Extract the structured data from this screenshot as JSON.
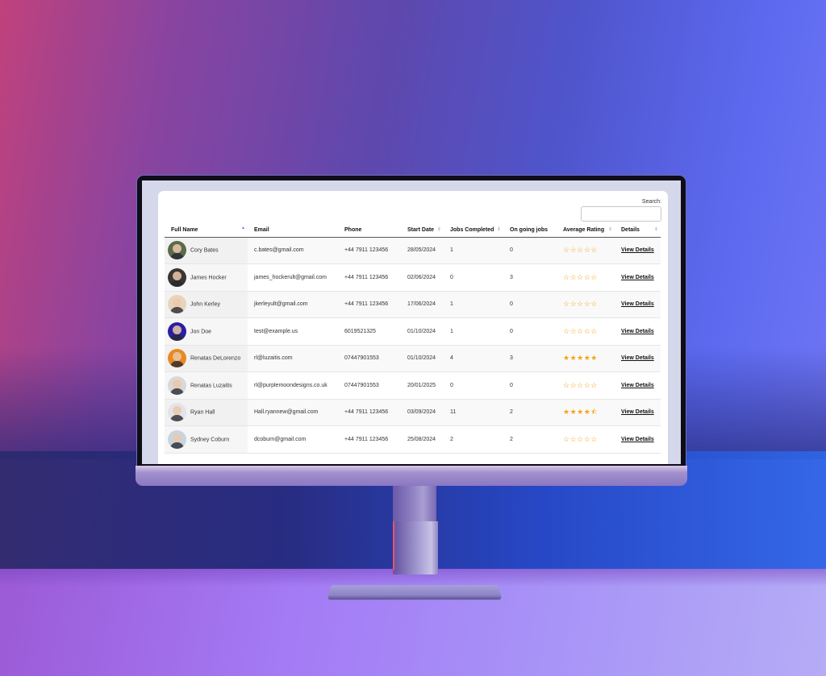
{
  "search": {
    "label": "Search:",
    "value": "",
    "placeholder": ""
  },
  "table": {
    "columns": [
      {
        "label": "Full Name",
        "sort": "asc"
      },
      {
        "label": "Email",
        "sort": "none"
      },
      {
        "label": "Phone",
        "sort": "none"
      },
      {
        "label": "Start Date",
        "sort": "sortable"
      },
      {
        "label": "Jobs Completed",
        "sort": "sortable"
      },
      {
        "label": "On going jobs",
        "sort": "none"
      },
      {
        "label": "Average Rating",
        "sort": "sortable"
      },
      {
        "label": "Details",
        "sort": "sortable"
      }
    ],
    "rows": [
      {
        "name": "Cory Bates",
        "email": "c.bates@gmail.com",
        "phone": "+44 7911 123456",
        "start_date": "28/05/2024",
        "jobs_completed": "1",
        "ongoing_jobs": "0",
        "rating": 0,
        "stars": "☆☆☆☆☆",
        "details": "View Details",
        "avatar_color": "#5a6a4a"
      },
      {
        "name": "James Hocker",
        "email": "james_hockerult@gmail.com",
        "phone": "+44 7911 123456",
        "start_date": "02/06/2024",
        "jobs_completed": "0",
        "ongoing_jobs": "3",
        "rating": 0,
        "stars": "☆☆☆☆☆",
        "details": "View Details",
        "avatar_color": "#3a3530"
      },
      {
        "name": "John Kerley",
        "email": "jkerleyult@gmail.com",
        "phone": "+44 7911 123456",
        "start_date": "17/06/2024",
        "jobs_completed": "1",
        "ongoing_jobs": "0",
        "rating": 0,
        "stars": "☆☆☆☆☆",
        "details": "View Details",
        "avatar_color": "#e8d4bc"
      },
      {
        "name": "Jon Doe",
        "email": "test@example.us",
        "phone": "6019521325",
        "start_date": "01/10/2024",
        "jobs_completed": "1",
        "ongoing_jobs": "0",
        "rating": 0,
        "stars": "☆☆☆☆☆",
        "details": "View Details",
        "avatar_color": "#2a1fa0"
      },
      {
        "name": "Renatas DeLorenzo",
        "email": "rl@luzaitis.com",
        "phone": "07447901553",
        "start_date": "01/10/2024",
        "jobs_completed": "4",
        "ongoing_jobs": "3",
        "rating": 5,
        "stars": "★★★★★",
        "details": "View Details",
        "avatar_color": "#e88a20"
      },
      {
        "name": "Renatas Luzaitis",
        "email": "rl@purplemoondesigns.co.uk",
        "phone": "07447901553",
        "start_date": "20/01/2025",
        "jobs_completed": "0",
        "ongoing_jobs": "0",
        "rating": 0,
        "stars": "☆☆☆☆☆",
        "details": "View Details",
        "avatar_color": "#d8d8d8"
      },
      {
        "name": "Ryan Hall",
        "email": "Hall.ryannew@gmail.com",
        "phone": "+44 7911 123456",
        "start_date": "03/09/2024",
        "jobs_completed": "11",
        "ongoing_jobs": "2",
        "rating": 4.5,
        "stars": "★★★★⯪",
        "details": "View Details",
        "avatar_color": "#e2e4e8"
      },
      {
        "name": "Sydney Coburn",
        "email": "dcoburn@gmail.com",
        "phone": "+44 7911 123456",
        "start_date": "25/08/2024",
        "jobs_completed": "2",
        "ongoing_jobs": "2",
        "rating": 0,
        "stars": "☆☆☆☆☆",
        "details": "View Details",
        "avatar_color": "#c8d4e0"
      }
    ]
  },
  "colors": {
    "star": "#f5a311",
    "sort_active": "#6b72d8"
  }
}
